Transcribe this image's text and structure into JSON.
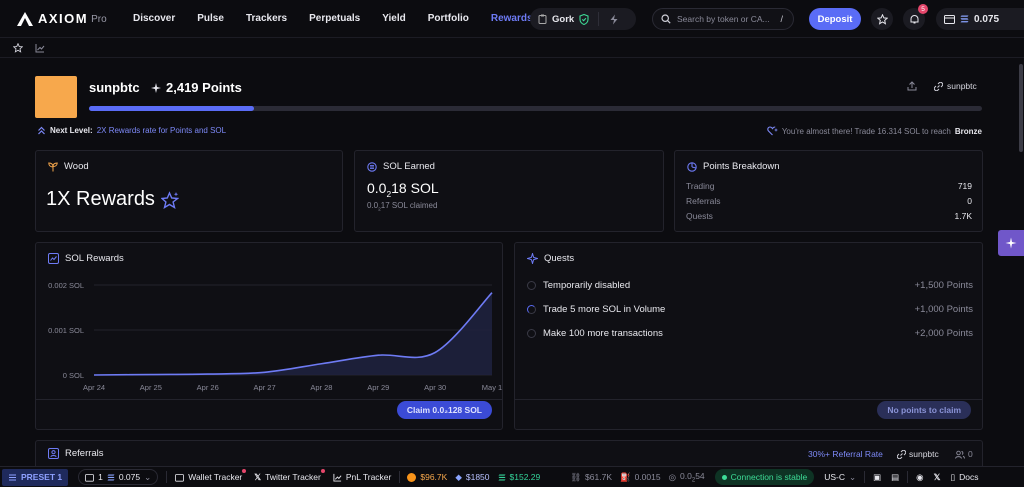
{
  "nav": {
    "logo": "AXIOM",
    "logo_sub": "Pro",
    "links": [
      "Discover",
      "Pulse",
      "Trackers",
      "Perpetuals",
      "Yield",
      "Portfolio",
      "Rewards"
    ],
    "active": "Rewards",
    "gork": "Gork",
    "search_placeholder": "Search by token or CA...",
    "search_shortcut": "/",
    "deposit": "Deposit",
    "notif_count": "5",
    "wallet_balance": "0.075"
  },
  "profile": {
    "username": "sunpbtc",
    "points": "2,419 Points",
    "handle": "sunpbtc",
    "progress_fraction": 0.185,
    "next_level_label": "Next Level:",
    "next_level_text": "2X Rewards rate for Points and SOL",
    "almost_text": "You're almost there! Trade 16.314 SOL to reach",
    "almost_target": "Bronze"
  },
  "tier_card": {
    "title": "Wood",
    "rewards": "1X Rewards"
  },
  "sol_card": {
    "title": "SOL Earned",
    "amount_pre": "0.0",
    "amount_sub": "2",
    "amount_post": "18 SOL",
    "claimed_pre": "0.0",
    "claimed_sub": "2",
    "claimed_post": "17 SOL claimed"
  },
  "breakdown": {
    "title": "Points Breakdown",
    "rows": [
      {
        "label": "Trading",
        "value": "719"
      },
      {
        "label": "Referrals",
        "value": "0"
      },
      {
        "label": "Quests",
        "value": "1.7K"
      }
    ]
  },
  "sol_rewards": {
    "title": "SOL Rewards",
    "claim_label": "Claim 0.0₂128 SOL"
  },
  "chart_data": {
    "type": "area",
    "title": "SOL Rewards",
    "x": [
      "Apr 24",
      "Apr 25",
      "Apr 26",
      "Apr 27",
      "Apr 28",
      "Apr 29",
      "Apr 30",
      "May 1"
    ],
    "yticks": [
      "0.002 SOL",
      "0.001 SOL",
      "0 SOL"
    ],
    "ylim": [
      0,
      0.002
    ],
    "series": [
      {
        "values": [
          0.0,
          1e-05,
          2e-05,
          6e-05,
          0.00025,
          0.00044,
          0.0005,
          0.00183
        ]
      }
    ],
    "color": "#6e7bf5"
  },
  "quests": {
    "title": "Quests",
    "items": [
      {
        "label": "Temporarily disabled",
        "points": "+1,500 Points",
        "state": "empty"
      },
      {
        "label": "Trade 5 more SOL in Volume",
        "points": "+1,000 Points",
        "state": "partial"
      },
      {
        "label": "Make 100 more transactions",
        "points": "+2,000 Points",
        "state": "empty"
      }
    ],
    "button": "No points to claim"
  },
  "referrals": {
    "title": "Referrals",
    "rate": "30%+ Referral Rate",
    "handle": "sunpbtc",
    "count": "0"
  },
  "bottom": {
    "preset": "PRESET 1",
    "wallet_count": "1",
    "wallet_balance": "0.075",
    "wallet_tracker": "Wallet Tracker",
    "twitter_tracker": "Twitter Tracker",
    "pnl_tracker": "PnL Tracker",
    "btc": "$96.7K",
    "eth": "$1850",
    "sol": "$152.29",
    "mcap": "$61.7K",
    "fee1": "0.0015",
    "fee2_pre": "0.0",
    "fee2_sub": "2",
    "fee2_post": "54",
    "connection": "Connection is stable",
    "region": "US-C",
    "docs": "Docs"
  }
}
